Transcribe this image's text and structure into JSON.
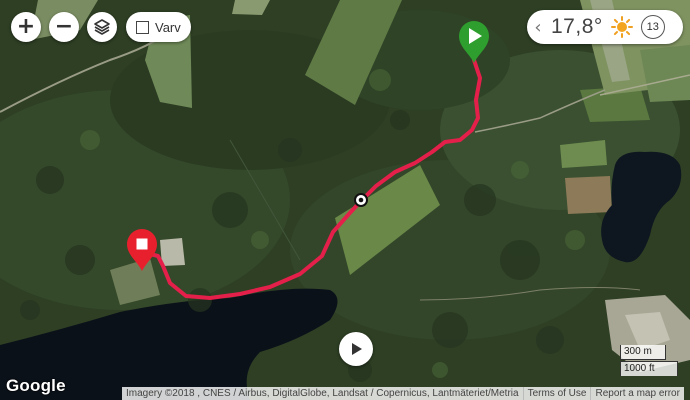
{
  "controls": {
    "zoom_in_label": "+",
    "zoom_out_label": "−",
    "layers_icon": "layers-icon",
    "laps_label": "Varv",
    "laps_checked": false
  },
  "weather": {
    "temperature": "17,8°",
    "condition_icon": "sun-icon",
    "wind_speed": "13"
  },
  "route": {
    "start_marker_icon": "play-marker-icon",
    "end_marker_icon": "stop-marker-icon",
    "start_color": "#2e9e2e",
    "end_color": "#e8202e",
    "track_color": "#e4204a"
  },
  "map": {
    "attribution": "Imagery ©2018 , CNES / Airbus, DigitalGlobe, Landsat / Copernicus, Lantmäteriet/Metria",
    "terms_link": "Terms of Use",
    "report_link": "Report a map error",
    "scale_metric": "300 m",
    "scale_imperial": "1000 ft",
    "logo": "Google"
  }
}
